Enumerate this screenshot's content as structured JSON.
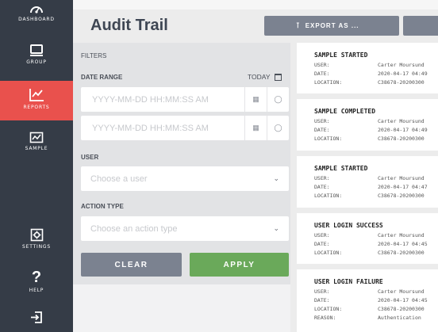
{
  "sidebar": {
    "items": [
      {
        "label": "DASHBOARD",
        "icon": "gauge-icon"
      },
      {
        "label": "GROUP",
        "icon": "monitor-icon"
      },
      {
        "label": "REPORTS",
        "icon": "line-chart-icon",
        "active": true
      },
      {
        "label": "SAMPLE",
        "icon": "sample-chart-icon"
      },
      {
        "label": "SETTINGS",
        "icon": "gear-icon"
      },
      {
        "label": "HELP",
        "icon": "question-icon"
      },
      {
        "label": "",
        "icon": "logout-icon"
      }
    ],
    "active_color": "#e9514d",
    "bg_color": "#353c47"
  },
  "header": {
    "title": "Audit Trail",
    "export_label": "EXPORT AS ..."
  },
  "filters": {
    "heading": "FILTERS",
    "date_range_label": "DATE RANGE",
    "today_label": "TODAY",
    "start_placeholder": "YYYY-MM-DD HH:MM:SS AM",
    "end_placeholder": "YYYY-MM-DD HH:MM:SS AM",
    "user_label": "USER",
    "user_placeholder": "Choose a user",
    "action_label": "ACTION TYPE",
    "action_placeholder": "Choose an action type",
    "clear_label": "CLEAR",
    "apply_label": "APPLY",
    "apply_color": "#6aa95a"
  },
  "events": [
    {
      "title": "SAMPLE STARTED",
      "user_key": "USER:",
      "user": "Carter Moursund",
      "date_key": "DATE:",
      "date": "2020-04-17 04:49",
      "location_key": "LOCATION:",
      "location": "C38678-20200300"
    },
    {
      "title": "SAMPLE COMPLETED",
      "user_key": "USER:",
      "user": "Carter Moursund",
      "date_key": "DATE:",
      "date": "2020-04-17 04:49",
      "location_key": "LOCATION:",
      "location": "C38678-20200300"
    },
    {
      "title": "SAMPLE STARTED",
      "user_key": "USER:",
      "user": "Carter Moursund",
      "date_key": "DATE:",
      "date": "2020-04-17 04:47",
      "location_key": "LOCATION:",
      "location": "C38678-20200300"
    },
    {
      "title": "USER LOGIN SUCCESS",
      "user_key": "USER:",
      "user": "Carter Moursund",
      "date_key": "DATE:",
      "date": "2020-04-17 04:45",
      "location_key": "LOCATION:",
      "location": "C38678-20200300"
    },
    {
      "title": "USER LOGIN FAILURE",
      "user_key": "USER:",
      "user": "Carter Moursund",
      "date_key": "DATE:",
      "date": "2020-04-17 04:45",
      "location_key": "LOCATION:",
      "location": "C38678-20200300",
      "reason_key": "REASON:",
      "reason": "Authentication"
    }
  ]
}
